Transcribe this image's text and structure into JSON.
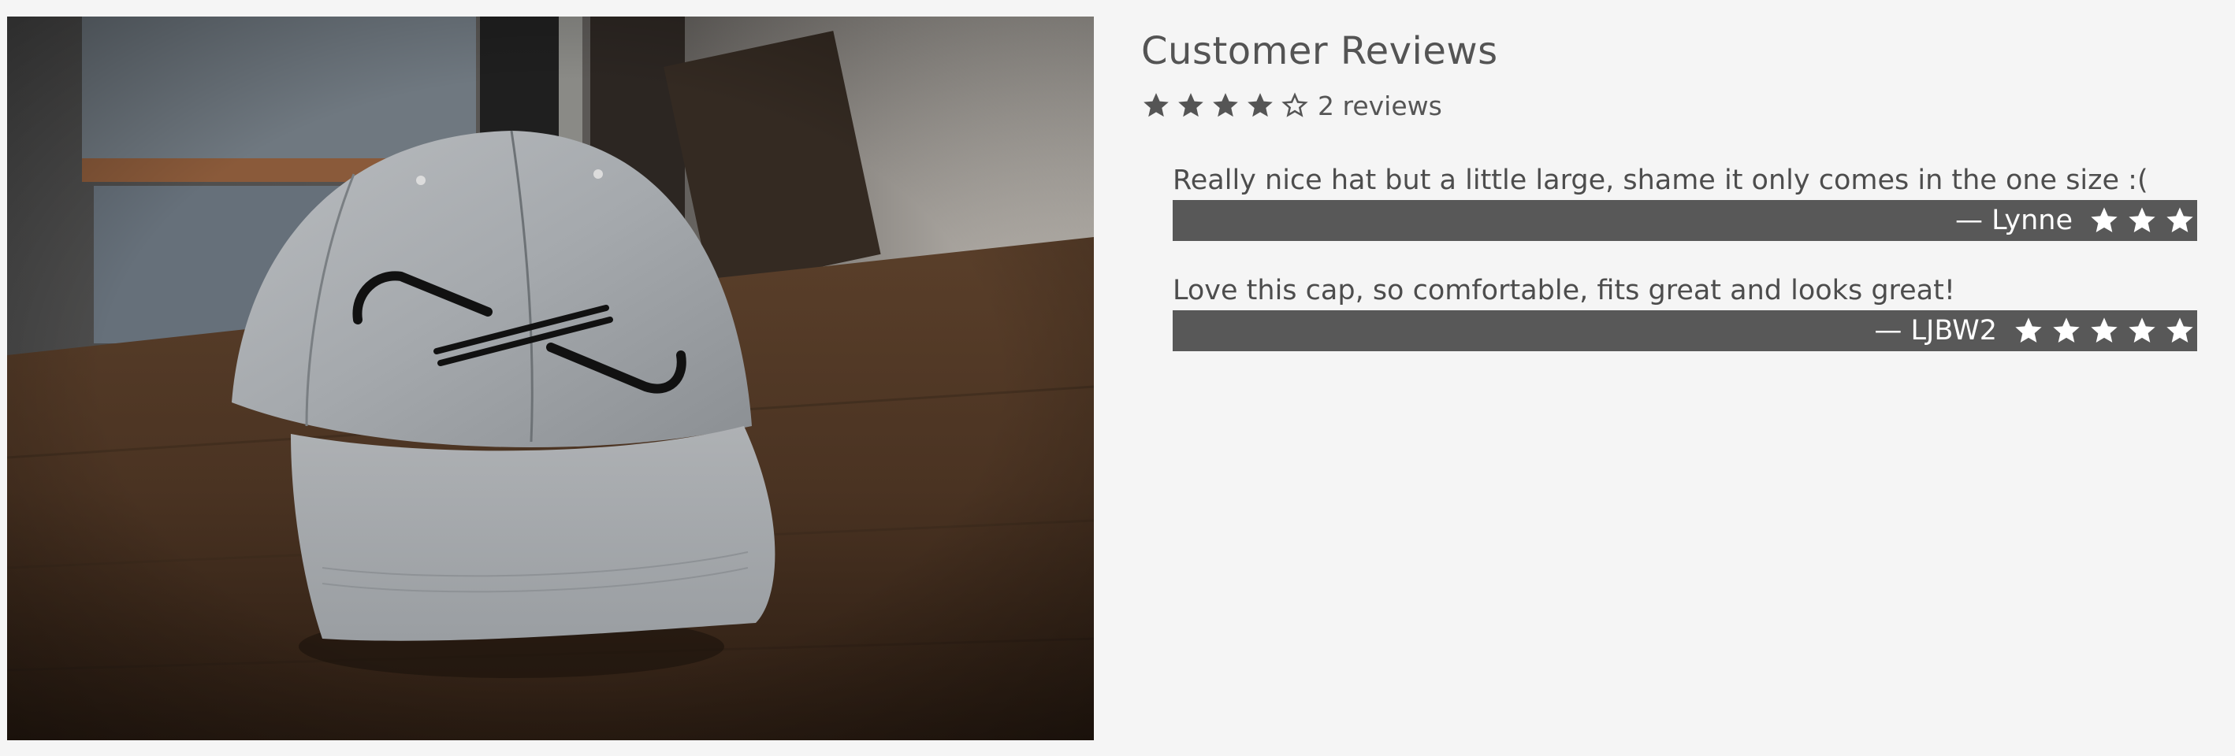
{
  "colors": {
    "page_background": "#f5f5f5",
    "text": "#4d4d4d",
    "review_bar": "#585858",
    "review_bar_text": "#ffffff",
    "star": "#555555"
  },
  "product_image": {
    "alt": "Grey baseball cap on wooden table",
    "icon": "product-photo"
  },
  "reviews_section": {
    "title": "Customer Reviews",
    "average_rating": 4,
    "max_rating": 5,
    "summary_text": "2 reviews",
    "reviews": [
      {
        "text": "Really nice hat but a little large, shame it only comes in the one size :(",
        "author": "— Lynne",
        "rating": 3
      },
      {
        "text": "Love this cap, so comfortable, fits great and looks great!",
        "author": "— LJBW2",
        "rating": 5
      }
    ]
  }
}
